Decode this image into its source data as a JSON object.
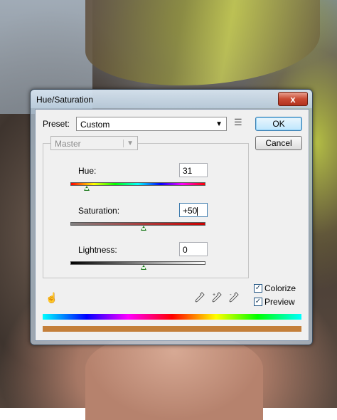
{
  "window": {
    "title": "Hue/Saturation",
    "close_glyph": "x"
  },
  "preset": {
    "label": "Preset:",
    "value": "Custom",
    "menu_icon": "list-options-icon"
  },
  "buttons": {
    "ok": "OK",
    "cancel": "Cancel"
  },
  "channel": {
    "value": "Master"
  },
  "sliders": {
    "hue": {
      "label": "Hue:",
      "value": "31"
    },
    "saturation": {
      "label": "Saturation:",
      "value": "+50"
    },
    "lightness": {
      "label": "Lightness:",
      "value": "0"
    }
  },
  "checkboxes": {
    "colorize": {
      "label": "Colorize",
      "checked": true
    },
    "preview": {
      "label": "Preview",
      "checked": true
    }
  },
  "colors": {
    "result_bar": "#c47f3a",
    "ok_focus": "#3c7fb1"
  },
  "icons": [
    "hand-adjust-icon",
    "eyedropper-icon",
    "eyedropper-plus-icon",
    "eyedropper-minus-icon"
  ]
}
